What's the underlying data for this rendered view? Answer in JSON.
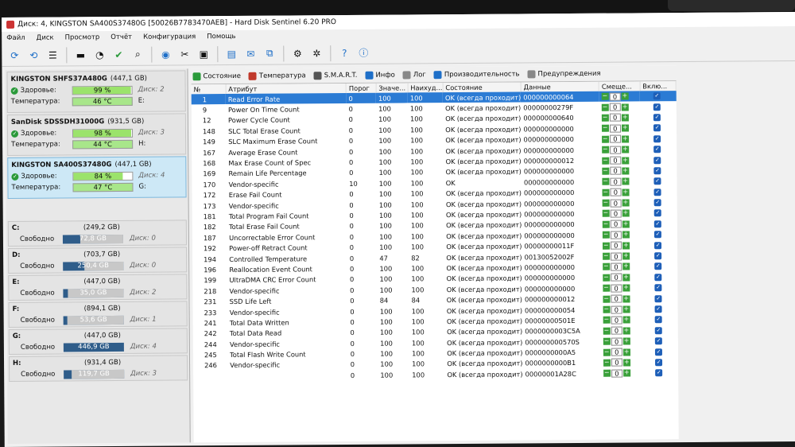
{
  "window": {
    "title": "Диск: 4, KINGSTON SA400S37480G [50026B7783470AEB] - Hard Disk Sentinel 6.20 PRO"
  },
  "menu": [
    "Файл",
    "Диск",
    "Просмотр",
    "Отчёт",
    "Конфигурация",
    "Помощь"
  ],
  "disks": [
    {
      "name": "KINGSTON SHFS37A480G",
      "size": "(447,1 GB)",
      "health_label": "Здоровье:",
      "health": "99 %",
      "health_pct": 99,
      "disk_no": "Диск: 2",
      "temp_label": "Температура:",
      "temp": "46 °C",
      "drive": "E:"
    },
    {
      "name": "SanDisk SDSSDH31000G",
      "size": "(931,5 GB)",
      "health_label": "Здоровье:",
      "health": "98 %",
      "health_pct": 98,
      "disk_no": "Диск: 3",
      "temp_label": "Температура:",
      "temp": "44 °C",
      "drive": "H:"
    },
    {
      "name": "KINGSTON SA400S37480G",
      "size": "(447,1 GB)",
      "health_label": "Здоровье:",
      "health": "84 %",
      "health_pct": 84,
      "disk_no": "Диск: 4",
      "temp_label": "Температура:",
      "temp": "47 °C",
      "drive": "G:"
    }
  ],
  "volumes": [
    {
      "letter": "C:",
      "total": "(249,2 GB)",
      "free_label": "Свободно",
      "free": "72,8 GB",
      "free_pct": 29,
      "disk": "Диск: 0"
    },
    {
      "letter": "D:",
      "total": "(703,7 GB)",
      "free_label": "Свободно",
      "free": "250,4 GB",
      "free_pct": 36,
      "disk": "Диск: 0"
    },
    {
      "letter": "E:",
      "total": "(447,0 GB)",
      "free_label": "Свободно",
      "free": "35,0 GB",
      "free_pct": 8,
      "disk": "Диск: 2"
    },
    {
      "letter": "F:",
      "total": "(894,1 GB)",
      "free_label": "Свободно",
      "free": "53,6 GB",
      "free_pct": 6,
      "disk": "Диск: 1"
    },
    {
      "letter": "G:",
      "total": "(447,0 GB)",
      "free_label": "Свободно",
      "free": "446,9 GB",
      "free_pct": 100,
      "disk": "Диск: 4"
    },
    {
      "letter": "H:",
      "total": "(931,4 GB)",
      "free_label": "Свободно",
      "free": "119,7 GB",
      "free_pct": 13,
      "disk": "Диск: 3"
    }
  ],
  "tabs": [
    "Состояние",
    "Температура",
    "S.M.A.R.T.",
    "Инфо",
    "Лог",
    "Производительность",
    "Предупреждения"
  ],
  "columns": [
    "№",
    "Атрибут",
    "Порог",
    "Значе...",
    "Наихуд...",
    "Состояние",
    "Данные",
    "Смеще...",
    "Вклю..."
  ],
  "rows": [
    [
      "1",
      "Read Error Rate",
      "0",
      "100",
      "100",
      "OK (всегда проходит)",
      "000000000064"
    ],
    [
      "9",
      "Power On Time Count",
      "0",
      "100",
      "100",
      "OK (всегда проходит)",
      "00000000279F"
    ],
    [
      "12",
      "Power Cycle Count",
      "0",
      "100",
      "100",
      "OK (всегда проходит)",
      "000000000640"
    ],
    [
      "148",
      "SLC Total Erase Count",
      "0",
      "100",
      "100",
      "OK (всегда проходит)",
      "000000000000"
    ],
    [
      "149",
      "SLC Maximum Erase Count",
      "0",
      "100",
      "100",
      "OK (всегда проходит)",
      "000000000000"
    ],
    [
      "167",
      "Average Erase Count",
      "0",
      "100",
      "100",
      "OK (всегда проходит)",
      "000000000000"
    ],
    [
      "168",
      "Max Erase Count of Spec",
      "0",
      "100",
      "100",
      "OK (всегда проходит)",
      "000000000012"
    ],
    [
      "169",
      "Remain Life Percentage",
      "0",
      "100",
      "100",
      "OK (всегда проходит)",
      "000000000000"
    ],
    [
      "170",
      "Vendor-specific",
      "10",
      "100",
      "100",
      "OK",
      "000000000000"
    ],
    [
      "172",
      "Erase Fail Count",
      "0",
      "100",
      "100",
      "OK (всегда проходит)",
      "000000000000"
    ],
    [
      "173",
      "Vendor-specific",
      "0",
      "100",
      "100",
      "OK (всегда проходит)",
      "000000000000"
    ],
    [
      "181",
      "Total Program Fail Count",
      "0",
      "100",
      "100",
      "OK (всегда проходит)",
      "000000000000"
    ],
    [
      "182",
      "Total Erase Fail Count",
      "0",
      "100",
      "100",
      "OK (всегда проходит)",
      "000000000000"
    ],
    [
      "187",
      "Uncorrectable Error Count",
      "0",
      "100",
      "100",
      "OK (всегда проходит)",
      "000000000000"
    ],
    [
      "192",
      "Power-off Retract Count",
      "0",
      "100",
      "100",
      "OK (всегда проходит)",
      "00000000011F"
    ],
    [
      "194",
      "Controlled Temperature",
      "0",
      "47",
      "82",
      "OK (всегда проходит)",
      "00130052002F"
    ],
    [
      "196",
      "Reallocation Event Count",
      "0",
      "100",
      "100",
      "OK (всегда проходит)",
      "000000000000"
    ],
    [
      "199",
      "UltraDMA CRC Error Count",
      "0",
      "100",
      "100",
      "OK (всегда проходит)",
      "000000000000"
    ],
    [
      "218",
      "Vendor-specific",
      "0",
      "100",
      "100",
      "OK (всегда проходит)",
      "000000000000"
    ],
    [
      "231",
      "SSD Life Left",
      "0",
      "84",
      "84",
      "OK (всегда проходит)",
      "000000000012"
    ],
    [
      "233",
      "Vendor-specific",
      "0",
      "100",
      "100",
      "OK (всегда проходит)",
      "000000000054"
    ],
    [
      "241",
      "Total Data Written",
      "0",
      "100",
      "100",
      "OK (всегда проходит)",
      "00000000501E"
    ],
    [
      "242",
      "Total Data Read",
      "0",
      "100",
      "100",
      "OK (всегда проходит)",
      "0000000003C5A"
    ],
    [
      "244",
      "Vendor-specific",
      "0",
      "100",
      "100",
      "OK (всегда проходит)",
      "000000000570S"
    ],
    [
      "245",
      "Total Flash Write Count",
      "0",
      "100",
      "100",
      "OK (всегда проходит)",
      "0000000000A5"
    ],
    [
      "246",
      "Vendor-specific",
      "0",
      "100",
      "100",
      "OK (всегда проходит)",
      "0000000000B1"
    ],
    [
      "",
      "",
      "0",
      "100",
      "100",
      "OK (всегда проходит)",
      "00000001A28C"
    ]
  ],
  "offset_value": "0",
  "colors": {
    "selected_row": "#2b7bd4",
    "health_bar": "#9be36b",
    "free_bar": "#2f5d8a"
  }
}
